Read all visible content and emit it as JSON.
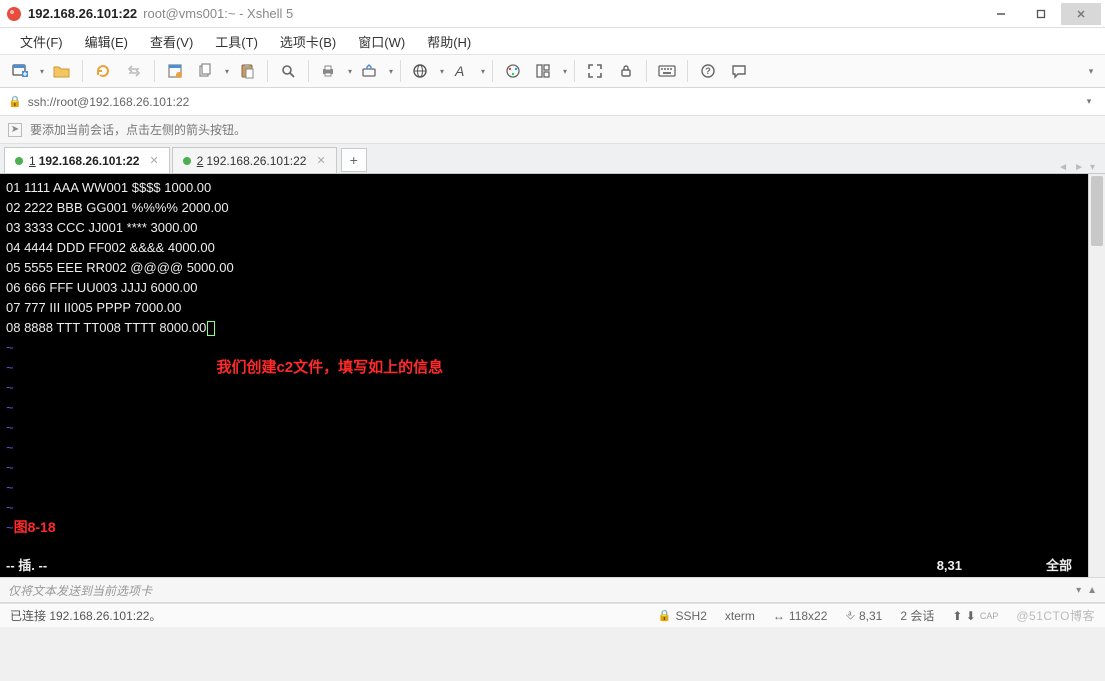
{
  "window": {
    "title_strong": "192.168.26.101:22",
    "title_sub": "root@vms001:~ - Xshell 5"
  },
  "menu": {
    "file": "文件(F)",
    "edit": "编辑(E)",
    "view": "查看(V)",
    "tools": "工具(T)",
    "tab": "选项卡(B)",
    "window": "窗口(W)",
    "help": "帮助(H)"
  },
  "addressbar": {
    "url": "ssh://root@192.168.26.101:22"
  },
  "hint": {
    "text": "要添加当前会话，点击左侧的箭头按钮。"
  },
  "tabs": [
    {
      "num": "1",
      "label": "192.168.26.101:22",
      "active": true
    },
    {
      "num": "2",
      "label": "192.168.26.101:22",
      "active": false
    }
  ],
  "terminal": {
    "lines": [
      "01 1111 AAA WW001 $$$$ 1000.00",
      "02 2222 BBB GG001 %%%% 2000.00",
      "03 3333 CCC JJ001 **** 3000.00",
      "04 4444 DDD FF002 &&&& 4000.00",
      "05 5555 EEE RR002 @@@@ 5000.00",
      "06 666 FFF UU003 JJJJ 6000.00",
      "07 777 III II005 PPPP 7000.00",
      "08 8888 TTT TT008 TTTT 8000.00"
    ],
    "annotation": "我们创建c2文件，填写如上的信息",
    "figure_label": "图8-18",
    "mode": "-- 插. --",
    "cursor_pos": "8,31",
    "scroll_pct": "全部"
  },
  "sendbar": {
    "placeholder": "仅将文本发送到当前选项卡"
  },
  "status": {
    "conn": "已连接 192.168.26.101:22。",
    "proto": "SSH2",
    "term": "xterm",
    "size": "118x22",
    "pos": "8,31",
    "sessions": "2 会话",
    "watermark": "@51CTO博客"
  }
}
